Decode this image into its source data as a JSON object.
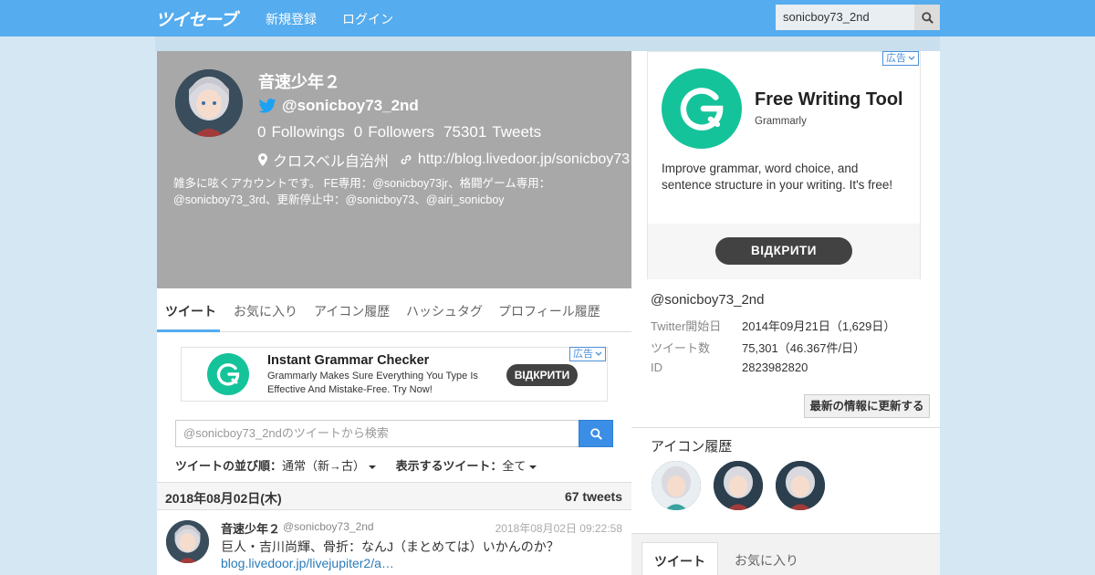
{
  "nav": {
    "logo": "ツイセーブ",
    "register": "新規登録",
    "login": "ログイン",
    "search_value": "sonicboy73_2nd"
  },
  "profile": {
    "name": "音速少年２",
    "handle": "@sonicboy73_2nd",
    "followings_count": "0",
    "followings_label": "Followings",
    "followers_count": "0",
    "followers_label": "Followers",
    "tweets_count": "75301",
    "tweets_label": "Tweets",
    "location": "クロスベル自治州",
    "url": "http://blog.livedoor.jp/sonicboy73",
    "bio": "雑多に呟くアカウントです。 FE専用：@sonicboy73jr、格闘ゲーム専用：@sonicboy73_3rd、更新停止中：@sonicboy73、@airi_sonicboy"
  },
  "tabs": [
    "ツイート",
    "お気に入り",
    "アイコン履歴",
    "ハッシュタグ",
    "プロフィール履歴"
  ],
  "ad_small": {
    "badge": "広告",
    "title": "Instant Grammar Checker",
    "desc": "Grammarly Makes Sure Everything You Type Is Effective And Mistake-Free. Try Now!",
    "button": "ВІДКРИТИ"
  },
  "tweet_search": {
    "placeholder": "@sonicboy73_2ndのツイートから検索"
  },
  "sort": {
    "order_label": "ツイートの並び順：",
    "order_value": "通常（新→古）",
    "show_label": "表示するツイート：",
    "show_value": "全て"
  },
  "datebar": {
    "date": "2018年08月02日(木)",
    "count": "67 tweets"
  },
  "tweet": {
    "name": "音速少年２",
    "handle": "@sonicboy73_2nd",
    "time": "2018年08月02日 09:22:58",
    "text": "巨人・吉川尚輝、骨折：なんJ（まとめては）いかんのか？ ",
    "link": "blog.livedoor.jp/livejupiter2/a…"
  },
  "ad_big": {
    "badge": "広告",
    "title": "Free Writing Tool",
    "brand": "Grammarly",
    "desc": "Improve grammar, word choice, and sentence structure in your writing. It's free!",
    "button": "ВІДКРИТИ"
  },
  "right": {
    "handle": "@sonicboy73_2nd",
    "rows": [
      {
        "k": "Twitter開始日",
        "v": "2014年09月21日（1,629日）"
      },
      {
        "k": "ツイート数",
        "v": "75,301（46.367件/日）"
      },
      {
        "k": "ID",
        "v": "2823982820"
      }
    ],
    "refresh": "最新の情報に更新する",
    "icon_history_title": "アイコン履歴",
    "bottom_tabs": [
      "ツイート",
      "お気に入り"
    ]
  },
  "colors": {
    "brand": "#55acee",
    "grammarly": "#15c39a"
  }
}
